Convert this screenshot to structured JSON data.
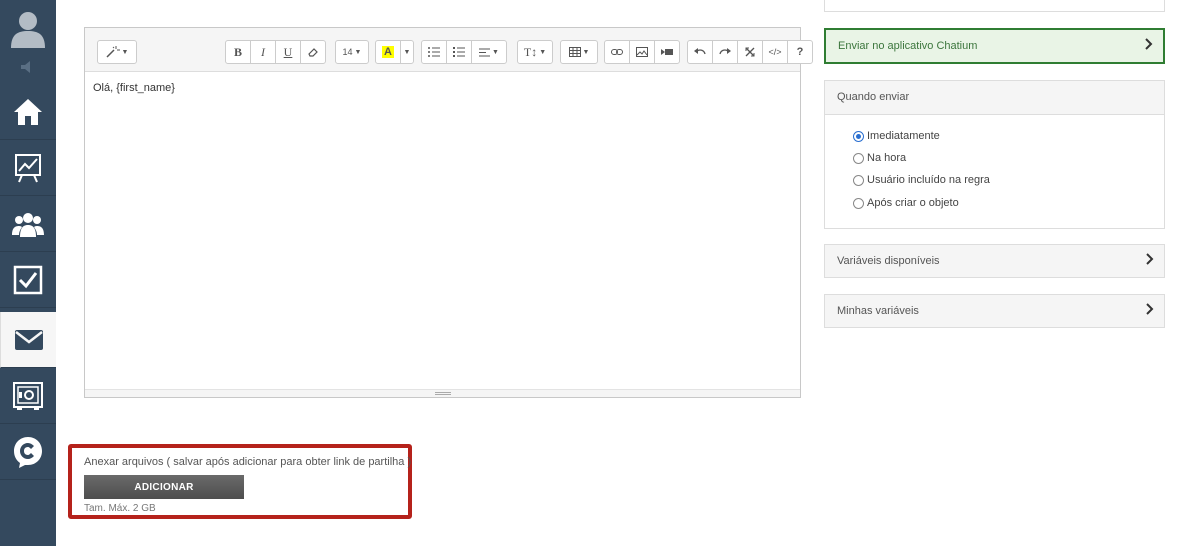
{
  "editor": {
    "font_size_label": "14",
    "text_style_label": "T↕",
    "content_text": "Olá, {first_name}"
  },
  "attachments": {
    "title": "Anexar arquivos ( salvar após adicionar para obter link de partilha )",
    "add_button_label": "ADICIONAR",
    "max_size_text": "Tam. Máx. 2 GB"
  },
  "right_panel": {
    "send_app_label": "Enviar no aplicativo Chatium",
    "when_to_send": {
      "title": "Quando enviar",
      "options": [
        {
          "label": "Imediatamente",
          "checked": true
        },
        {
          "label": "Na hora",
          "checked": false
        },
        {
          "label": "Usuário incluído na regra",
          "checked": false
        },
        {
          "label": "Após criar o objeto",
          "checked": false
        }
      ]
    },
    "available_vars_label": "Variáveis disponíveis",
    "my_vars_label": "Minhas variáveis"
  },
  "colors": {
    "sidebar_bg": "#34495e",
    "highlight_border": "#b5221b",
    "success_border": "#2f7d32",
    "success_bg": "#e9f4e6"
  }
}
